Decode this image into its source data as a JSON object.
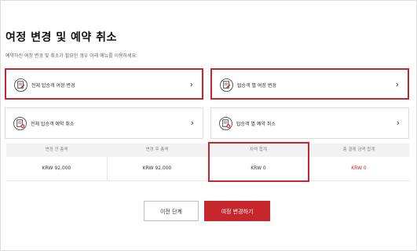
{
  "page": {
    "title": "여정 변경 및 예약 취소",
    "subtitle": "예약하신 여정 변경 및 취소가 필요한 경우 아래 메뉴를 이용하세요."
  },
  "cards": [
    {
      "label": "전체 탑승객 여정 변경",
      "icon": "document-edit-icon",
      "highlighted": true
    },
    {
      "label": "탑승객 별 여정 변경",
      "icon": "document-edit-icon",
      "highlighted": true
    },
    {
      "label": "전체 탑승객 예약 취소",
      "icon": "document-cancel-icon",
      "highlighted": false
    },
    {
      "label": "탑승객 별 예약 취소",
      "icon": "document-cancel-icon",
      "highlighted": false
    }
  ],
  "summary": {
    "headers": [
      "변경 전 총액",
      "변경 후 총액",
      "차액 합계",
      "총 결제 금액 합계"
    ],
    "values": [
      "KRW 92,000",
      "KRW 92,000",
      "KRW 0",
      "KRW 0"
    ]
  },
  "buttons": {
    "prev": "이전 단계",
    "next": "여정 변경하기"
  },
  "colors": {
    "accent": "#c7262c",
    "header_bg": "#f2f2f2",
    "border": "#dddddd"
  }
}
